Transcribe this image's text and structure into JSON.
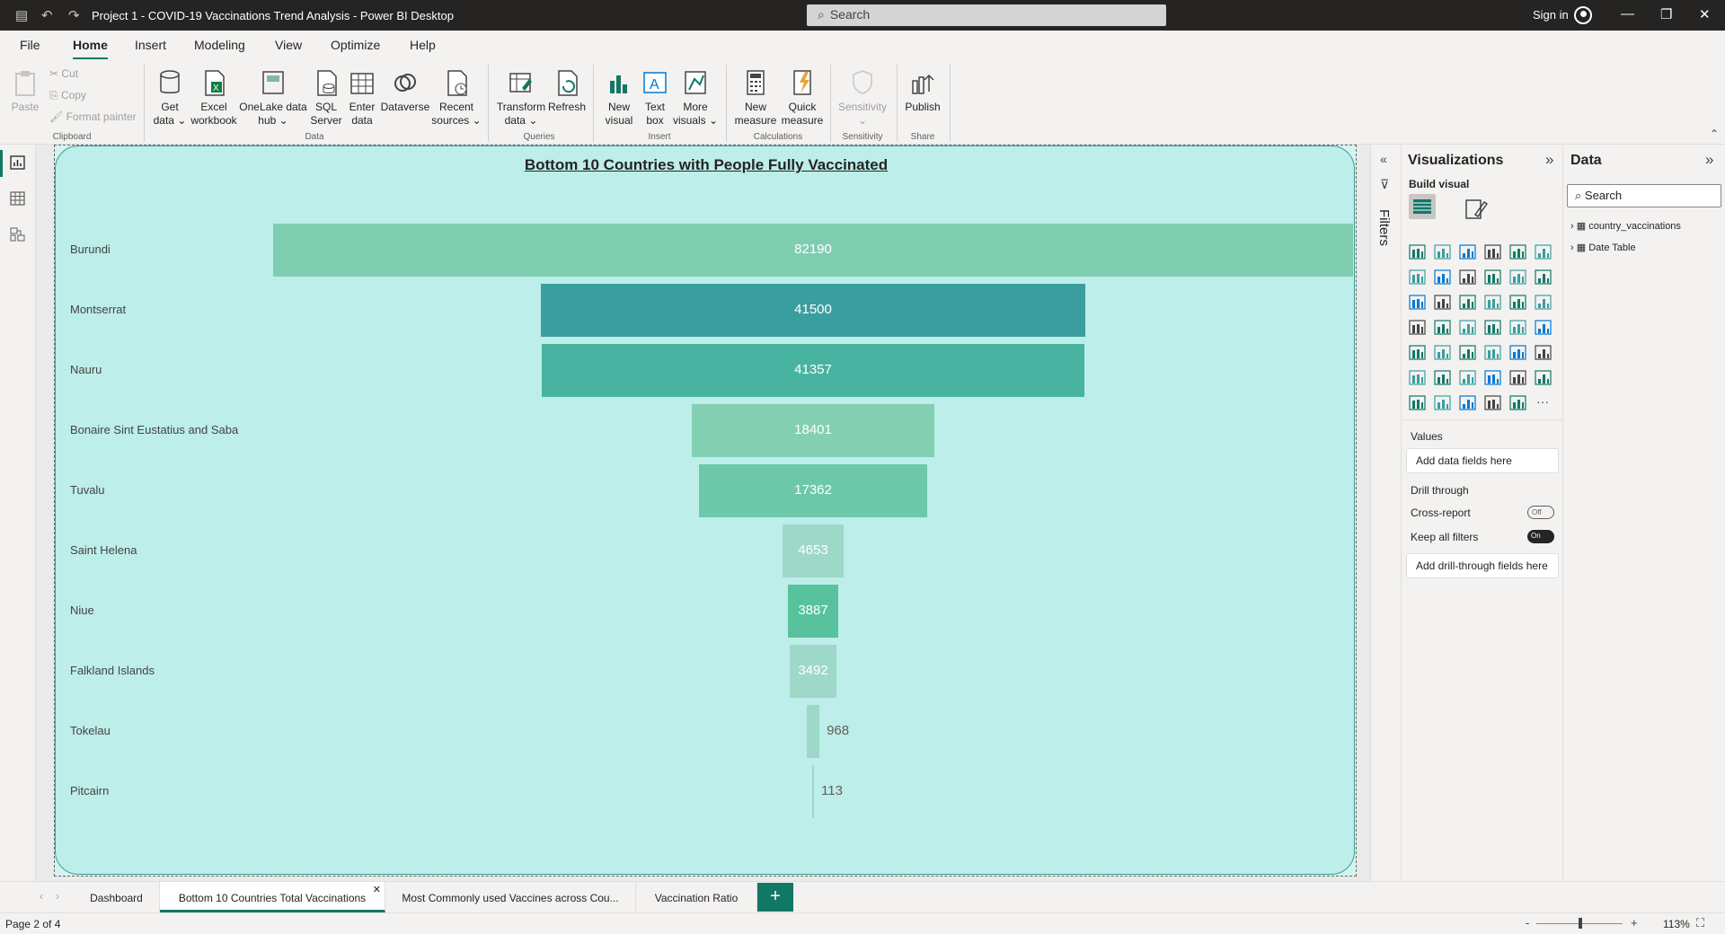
{
  "window": {
    "title": "Project 1 - COVID-19 Vaccinations Trend Analysis - Power BI Desktop",
    "search_placeholder": "Search",
    "sign_in": "Sign in"
  },
  "menu": [
    "File",
    "Home",
    "Insert",
    "Modeling",
    "View",
    "Optimize",
    "Help"
  ],
  "ribbon": {
    "clipboard": {
      "paste": "Paste",
      "cut": "Cut",
      "copy": "Copy",
      "format_painter": "Format painter",
      "group": "Clipboard"
    },
    "data": {
      "get_data_1": "Get",
      "get_data_2": "data",
      "excel_1": "Excel",
      "excel_2": "workbook",
      "onelake_1": "OneLake data",
      "onelake_2": "hub",
      "sql_1": "SQL",
      "sql_2": "Server",
      "enter_1": "Enter",
      "enter_2": "data",
      "dataverse": "Dataverse",
      "recent_1": "Recent",
      "recent_2": "sources",
      "group": "Data"
    },
    "queries": {
      "transform_1": "Transform",
      "transform_2": "data",
      "refresh": "Refresh",
      "group": "Queries"
    },
    "insert": {
      "newvisual_1": "New",
      "newvisual_2": "visual",
      "textbox_1": "Text",
      "textbox_2": "box",
      "more_1": "More",
      "more_2": "visuals",
      "group": "Insert"
    },
    "calculations": {
      "newmeasure_1": "New",
      "newmeasure_2": "measure",
      "quick_1": "Quick",
      "quick_2": "measure",
      "group": "Calculations"
    },
    "sensitivity": {
      "label": "Sensitivity",
      "group": "Sensitivity"
    },
    "share": {
      "publish": "Publish",
      "group": "Share"
    }
  },
  "chart_data": {
    "type": "bar",
    "title": "Bottom 10 Countries with People Fully Vaccinated",
    "categories": [
      "Burundi",
      "Montserrat",
      "Nauru",
      "Bonaire Sint Eustatius and Saba",
      "Tuvalu",
      "Saint Helena",
      "Niue",
      "Falkland Islands",
      "Tokelau",
      "Pitcairn"
    ],
    "values": [
      82190,
      41500,
      41357,
      18401,
      17362,
      4653,
      3887,
      3492,
      968,
      113
    ],
    "labels": [
      "82190",
      "41500",
      "41357",
      "18401",
      "17362",
      "4653",
      "3887",
      "3492",
      "968",
      "113"
    ],
    "colors": [
      "#7fcdb0",
      "#3a9e9e",
      "#48b3a0",
      "#82cfb2",
      "#6dc8aa",
      "#9ed8c8",
      "#58c29d",
      "#9ed8c8",
      "#9ed8c8",
      "#9ed8c8"
    ],
    "style": "funnel"
  },
  "filters_label": "Filters",
  "visualizations": {
    "title": "Visualizations",
    "build_visual": "Build visual",
    "values_label": "Values",
    "values_placeholder": "Add data fields here",
    "drill_through": "Drill through",
    "cross_report": "Cross-report",
    "cross_report_state": "Off",
    "keep_filters": "Keep all filters",
    "keep_filters_state": "On",
    "drill_placeholder": "Add drill-through fields here"
  },
  "data_pane": {
    "title": "Data",
    "search_placeholder": "Search",
    "tables": [
      "country_vaccinations",
      "Date Table"
    ]
  },
  "tabs": [
    "Dashboard",
    "Bottom 10 Countries Total Vaccinations",
    "Most Commonly used Vaccines across Cou...",
    "Vaccination Ratio"
  ],
  "active_tab_index": 1,
  "status": {
    "page": "Page 2 of 4",
    "zoom": "113%"
  }
}
